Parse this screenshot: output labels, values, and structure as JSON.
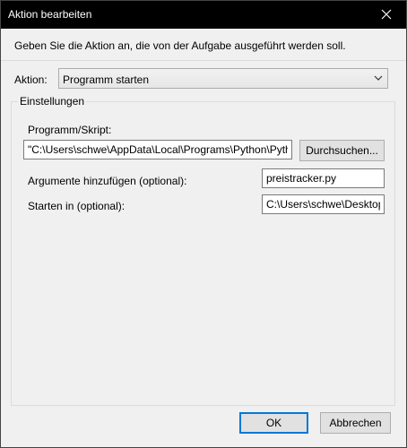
{
  "window": {
    "title": "Aktion bearbeiten"
  },
  "instruction": "Geben Sie die Aktion an, die von der Aufgabe ausgeführt werden soll.",
  "action": {
    "label": "Aktion:",
    "selected": "Programm starten"
  },
  "settings": {
    "legend": "Einstellungen",
    "program_label": "Programm/Skript:",
    "program_value": "\"C:\\Users\\schwe\\AppData\\Local\\Programs\\Python\\Python",
    "browse_label": "Durchsuchen...",
    "args_label": "Argumente hinzufügen (optional):",
    "args_value": "preistracker.py",
    "start_label": "Starten in (optional):",
    "start_value": "C:\\Users\\schwe\\Desktop"
  },
  "buttons": {
    "ok": "OK",
    "cancel": "Abbrechen"
  },
  "colors": {
    "titlebar": "#000000",
    "dialog_bg": "#f0f0f0",
    "focus_border": "#0078d7"
  },
  "icons": {
    "close": "close-icon",
    "dropdown": "chevron-down-icon"
  }
}
